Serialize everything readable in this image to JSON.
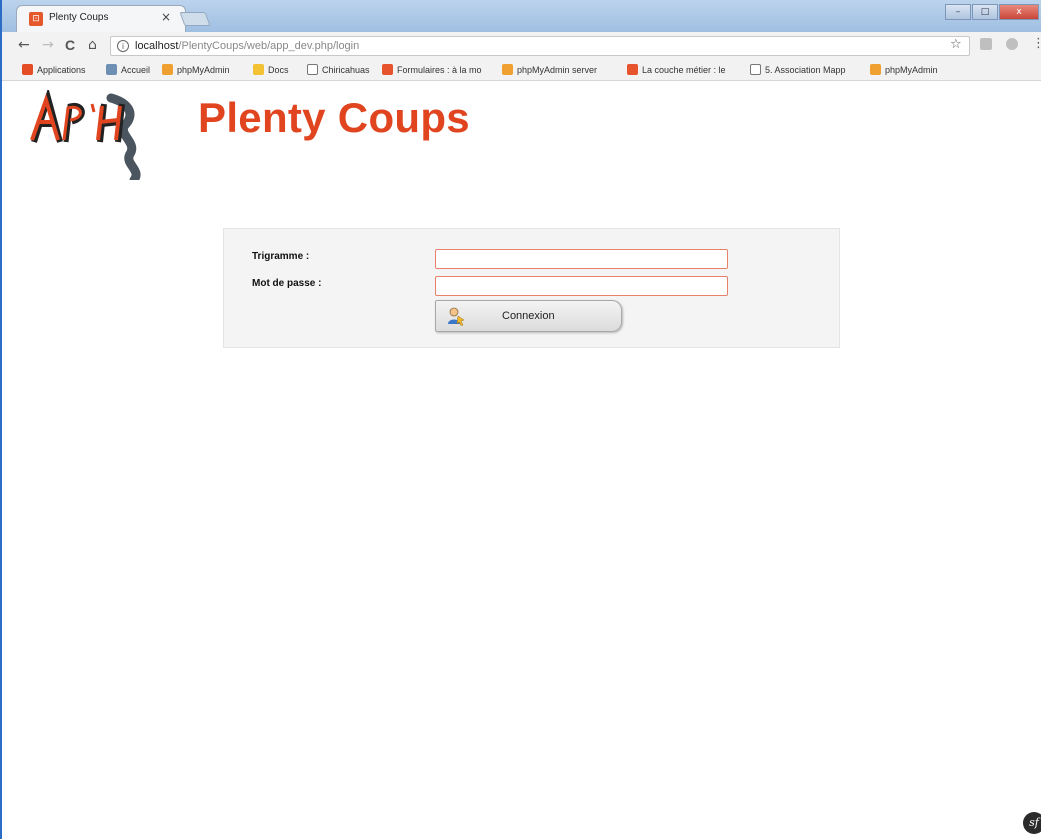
{
  "browser": {
    "tab_title": "Plenty Coups",
    "tab_close": "×",
    "url_host": "localhost",
    "url_path": "/PlentyCoups/web/app_dev.php/login",
    "nav": {
      "back": "←",
      "forward": "→",
      "reload": "C",
      "home": "⌂"
    },
    "window_controls": {
      "minimize": "–",
      "maximize": "□",
      "close": "x"
    },
    "bookmarks": [
      {
        "label": "Applications",
        "icon": "apps-grid-icon",
        "color": "#e44d26"
      },
      {
        "label": "Accueil",
        "icon": "image-icon",
        "color": "#6d8fb3"
      },
      {
        "label": "phpMyAdmin",
        "icon": "phpmyadmin-icon",
        "color": "#f0a030"
      },
      {
        "label": "Docs",
        "icon": "folder-icon",
        "color": "#f2c232"
      },
      {
        "label": "Chiricahuas",
        "icon": "page-icon",
        "color": "#ffffff"
      },
      {
        "label": "Formulaires : à la mo",
        "icon": "bookmark-icon",
        "color": "#e6532c"
      },
      {
        "label": "phpMyAdmin server",
        "icon": "phpmyadmin-icon",
        "color": "#f0a030"
      },
      {
        "label": "La couche métier : le",
        "icon": "bookmark-icon",
        "color": "#e6532c"
      },
      {
        "label": "5. Association Mapp",
        "icon": "page-icon",
        "color": "#ffffff"
      },
      {
        "label": "phpMyAdmin",
        "icon": "phpmyadmin-icon",
        "color": "#f0a030"
      }
    ]
  },
  "header": {
    "logo_text": "AP'H",
    "title": "Plenty Coups",
    "title_color": "#e04520"
  },
  "login": {
    "trigram_label": "Trigramme :",
    "password_label": "Mot de passe :",
    "trigram_value": "",
    "password_value": "",
    "submit_label": "Connexion"
  },
  "footer": {
    "symfony_badge": "sf"
  }
}
